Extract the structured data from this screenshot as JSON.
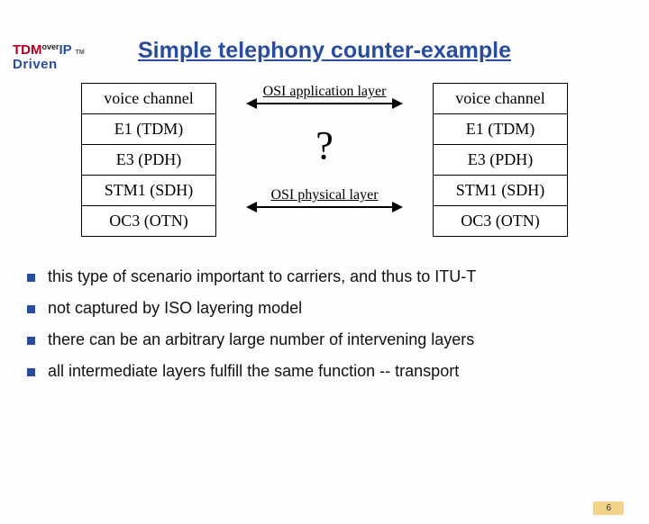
{
  "logo": {
    "line1_tdm": "TDM",
    "line1_over": "over",
    "line1_ip": "IP",
    "tm": "TM",
    "line2": "Driven"
  },
  "title": "Simple telephony counter-example",
  "stack_left": [
    "voice channel",
    "E1 (TDM)",
    "E3 (PDH)",
    "STM1 (SDH)",
    "OC3 (OTN)"
  ],
  "stack_right": [
    "voice channel",
    "E1 (TDM)",
    "E3 (PDH)",
    "STM1 (SDH)",
    "OC3 (OTN)"
  ],
  "middle": {
    "top_label": "OSI application layer",
    "question": "?",
    "bottom_label": "OSI physical layer"
  },
  "bullets": [
    "this type of scenario important to carriers, and thus to ITU-T",
    "not captured by ISO layering model",
    "there can be an arbitrary large number of intervening layers",
    "all intermediate layers fulfill the same function -- transport"
  ],
  "page_number": "6"
}
